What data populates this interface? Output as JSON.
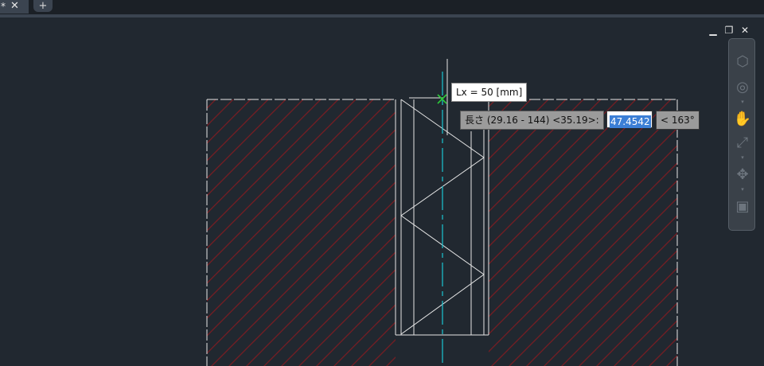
{
  "tabs": [
    {
      "label": "*",
      "close_glyph": "✕"
    }
  ],
  "new_tab_glyph": "+",
  "window_controls": {
    "minimize_glyph": "▁",
    "restore_glyph": "❐",
    "close_glyph": "✕"
  },
  "navbar": {
    "items": [
      {
        "icon": "viewcube-icon",
        "glyph": "⬡"
      },
      {
        "icon": "steering-wheel-icon",
        "glyph": "◎"
      },
      {
        "icon": "pan-icon",
        "glyph": "✋"
      },
      {
        "icon": "zoom-extents-icon",
        "glyph": "⤢"
      },
      {
        "icon": "orbit-icon",
        "glyph": "✥"
      },
      {
        "icon": "showmotion-icon",
        "glyph": "▣"
      }
    ],
    "caret_glyph": "▾"
  },
  "dynamic_input": {
    "lx_tooltip": "Lx = 50 [mm]",
    "prompt": "長さ (29.16 - 144) <35.19>:",
    "value": "47.4542",
    "angle": "< 163°"
  },
  "colors": {
    "background": "#212830",
    "outline": "#e6e6e6",
    "hatch": "#7a1b22",
    "centerline": "#19c6d2",
    "snap_marker": "#2ccc3a"
  }
}
